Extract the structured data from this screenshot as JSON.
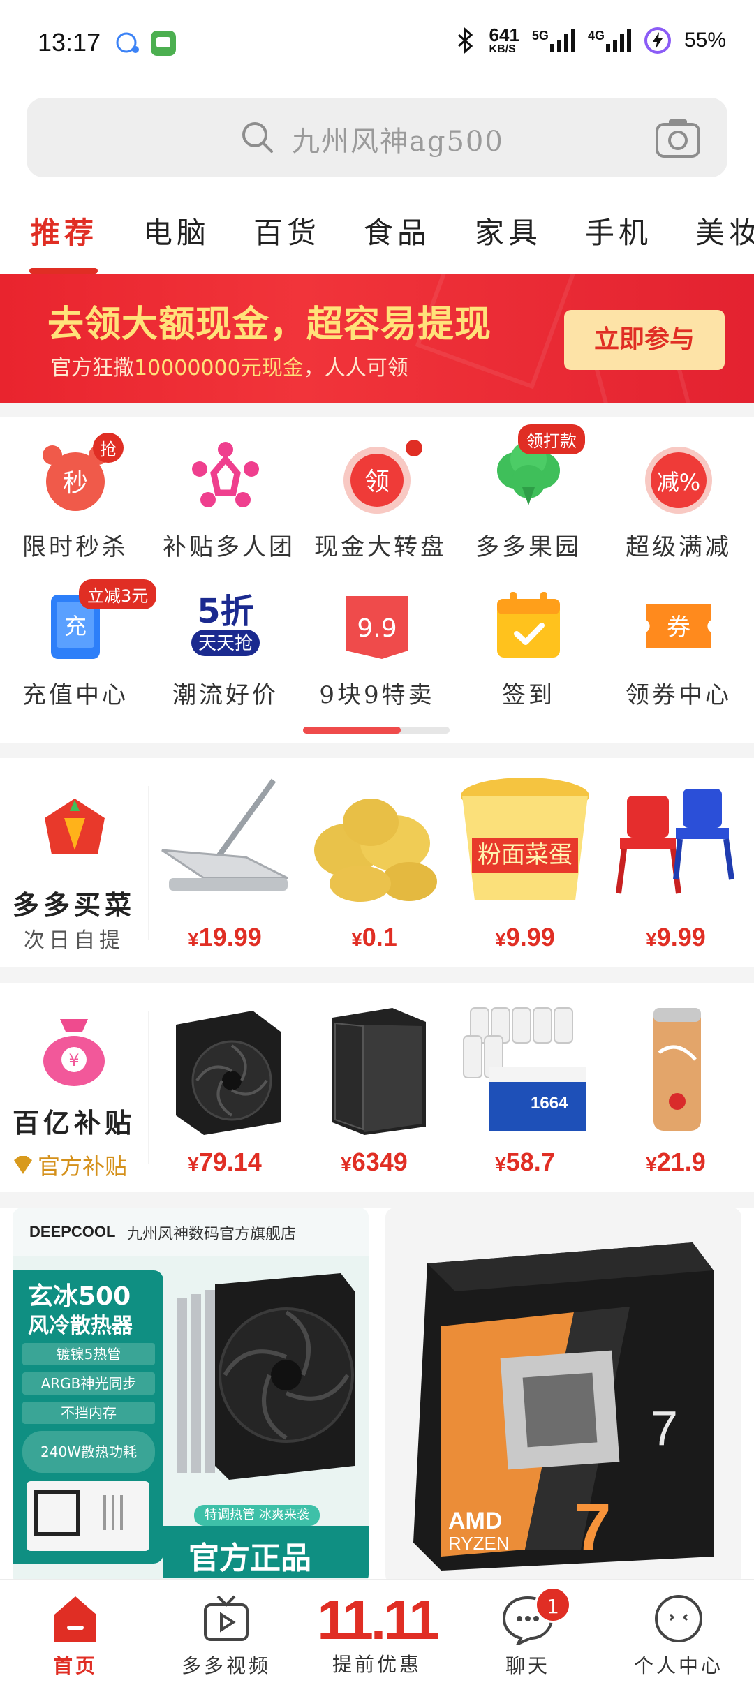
{
  "status_bar": {
    "time": "13:17",
    "net_speed": "641",
    "net_unit": "KB/S",
    "network_1": "5G",
    "network_2": "4G",
    "battery": "55%"
  },
  "search": {
    "placeholder": "九州风神ag500",
    "search_icon": "search-icon",
    "camera_icon": "camera-icon"
  },
  "tabs": [
    {
      "label": "推荐",
      "active": true
    },
    {
      "label": "电脑"
    },
    {
      "label": "百货"
    },
    {
      "label": "食品"
    },
    {
      "label": "家具"
    },
    {
      "label": "手机"
    },
    {
      "label": "美妆"
    }
  ],
  "banner": {
    "title": "去领大额现金，超容易提现",
    "subtitle_prefix": "官方狂撒",
    "subtitle_amount": "10000000元现金",
    "subtitle_suffix": "，人人可领",
    "button": "立即参与"
  },
  "shortcuts": [
    {
      "label": "限时秒杀",
      "icon": "alarm-clock-icon",
      "glyph": "秒",
      "tag": "抢"
    },
    {
      "label": "补贴多人团",
      "icon": "group-people-icon"
    },
    {
      "label": "现金大转盘",
      "icon": "wheel-icon",
      "glyph": "领"
    },
    {
      "label": "多多果园",
      "icon": "tree-icon",
      "tag": "领打款"
    },
    {
      "label": "超级满减",
      "icon": "discount-icon",
      "glyph": "减%"
    },
    {
      "label": "充值中心",
      "icon": "phone-topup-icon",
      "glyph": "充",
      "tag": "立减3元"
    },
    {
      "label": "潮流好价",
      "icon": "half-price-icon",
      "glyph": "5折",
      "glyph2": "天天抢"
    },
    {
      "label": "9块9特卖",
      "icon": "tag-99-icon",
      "glyph": "9.9"
    },
    {
      "label": "签到",
      "icon": "calendar-check-icon"
    },
    {
      "label": "领券中心",
      "icon": "coupon-icon",
      "glyph": "券"
    }
  ],
  "grocery_row": {
    "title": "多多买菜",
    "subtitle": "次日自提",
    "items": [
      {
        "name": "mop",
        "price": "19.99"
      },
      {
        "name": "potatoes",
        "price": "0.1"
      },
      {
        "name": "instant-noodles",
        "price": "9.99",
        "label": "粉面菜蛋"
      },
      {
        "name": "kids-chairs",
        "price": "9.99"
      }
    ]
  },
  "subsidy_row": {
    "title": "百亿补贴",
    "subtitle": "官方补贴",
    "items": [
      {
        "name": "cpu-cooler",
        "price": "79.14"
      },
      {
        "name": "pc-case",
        "price": "6349"
      },
      {
        "name": "beer-cans",
        "price": "58.7"
      },
      {
        "name": "cola-can",
        "price": "21.9"
      }
    ]
  },
  "currency": "¥",
  "feed": {
    "card1": {
      "brand": "DEEPCOOL",
      "store": "九州风神数码官方旗舰店",
      "title1": "玄冰500",
      "title2": "风冷散热器",
      "features": [
        "镀镍5热管",
        "ARGB神光同步",
        "不挡内存",
        "240W散热功耗"
      ],
      "ribbon": "特调热管 冰爽来袭",
      "footer": "官方正品"
    },
    "card2": {
      "brand": "AMD",
      "product": "RYZEN",
      "number": "7"
    }
  },
  "bottom_nav": [
    {
      "label": "首页",
      "icon": "home-icon",
      "active": true
    },
    {
      "label": "多多视频",
      "icon": "video-icon"
    },
    {
      "label": "提前优惠",
      "icon": "promo-1111-icon",
      "promo": "11.11"
    },
    {
      "label": "聊天",
      "icon": "chat-icon",
      "badge": "1"
    },
    {
      "label": "个人中心",
      "icon": "profile-icon"
    }
  ],
  "colors": {
    "accent": "#e02e24",
    "banner": "#e9242e",
    "gold": "#ffe27a"
  }
}
